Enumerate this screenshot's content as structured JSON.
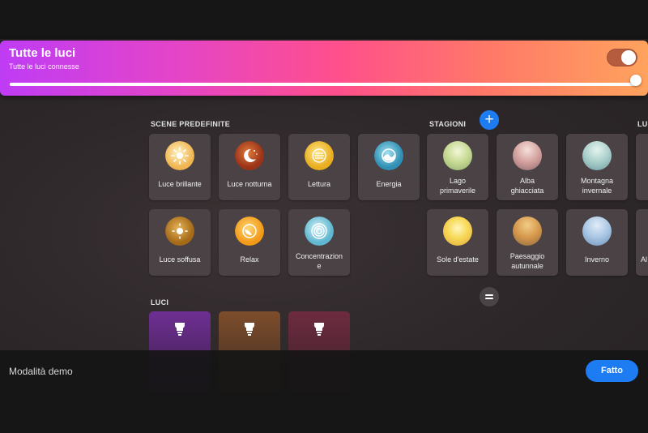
{
  "header": {
    "title": "Tutte le luci",
    "subtitle": "Tutte le luci connesse",
    "power_on": true,
    "brightness_percent": 100
  },
  "sections": {
    "predefined": "SCENE PREDEFINITE",
    "seasons": "STAGIONI",
    "partial": "LU",
    "lights": "LUCI"
  },
  "predefined_scenes": [
    {
      "label": "Luce brillante",
      "icon": "sun-icon",
      "color": "#f6d58a"
    },
    {
      "label": "Luce notturna",
      "icon": "moon-icon",
      "color": "#c4521f"
    },
    {
      "label": "Lettura",
      "icon": "book-icon",
      "color": "#f4c83f"
    },
    {
      "label": "Energia",
      "icon": "energy-icon",
      "color": "#5fb9d4"
    },
    {
      "label": "Luce soffusa",
      "icon": "dim-sun-icon",
      "color": "#c8922e"
    },
    {
      "label": "Relax",
      "icon": "relax-icon",
      "color": "#f9b63a"
    },
    {
      "label": "Concentrazione",
      "icon": "target-icon",
      "color": "#8ccfe0"
    }
  ],
  "season_scenes": [
    {
      "label": "Lago primaverile",
      "icon": "lake-image",
      "color": "#c7d89a"
    },
    {
      "label": "Alba ghiacciata",
      "icon": "frost-image",
      "color": "#d9a9a4"
    },
    {
      "label": "Montagna invernale",
      "icon": "mountain-image",
      "color": "#a9d0cc"
    },
    {
      "label": "Sole d'estate",
      "icon": "summer-sun-image",
      "color": "#f7da5e"
    },
    {
      "label": "Paesaggio autunnale",
      "icon": "autumn-image",
      "color": "#d69a4f"
    },
    {
      "label": "Inverno",
      "icon": "winter-image",
      "color": "#a8c7e6"
    }
  ],
  "partial_col": [
    "Al"
  ],
  "lights": [
    {
      "icon": "bulb-icon",
      "color": "#6b2d8c"
    },
    {
      "icon": "bulb-icon",
      "color": "#7a4a2a"
    },
    {
      "icon": "bulb-icon",
      "color": "#6b2a3e"
    }
  ],
  "footer": {
    "demo_label": "Modalità demo",
    "done_label": "Fatto"
  },
  "accent_color": "#1d7cf2"
}
